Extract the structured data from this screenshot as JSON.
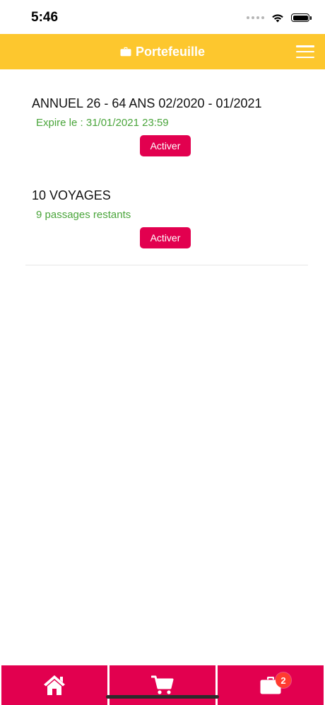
{
  "status_bar": {
    "time": "5:46"
  },
  "header": {
    "title": "Portefeuille",
    "title_icon": "briefcase-icon",
    "menu_icon": "hamburger-menu-icon",
    "background_color": "#fdc72e"
  },
  "tickets": [
    {
      "title": "ANNUEL 26 - 64 ANS 02/2020 - 01/2021",
      "status": "Expire le : 31/01/2021 23:59",
      "button_label": "Activer"
    },
    {
      "title": "10 VOYAGES",
      "status": "9 passages restants",
      "button_label": "Activer"
    }
  ],
  "tab_bar": {
    "items": [
      {
        "icon": "home-icon"
      },
      {
        "icon": "cart-icon"
      },
      {
        "icon": "briefcase-icon",
        "badge": "2"
      }
    ],
    "background_color": "#e2004f"
  },
  "colors": {
    "status_text": "#4aa53b",
    "button": "#e2004f",
    "badge": "#ff3b30"
  }
}
